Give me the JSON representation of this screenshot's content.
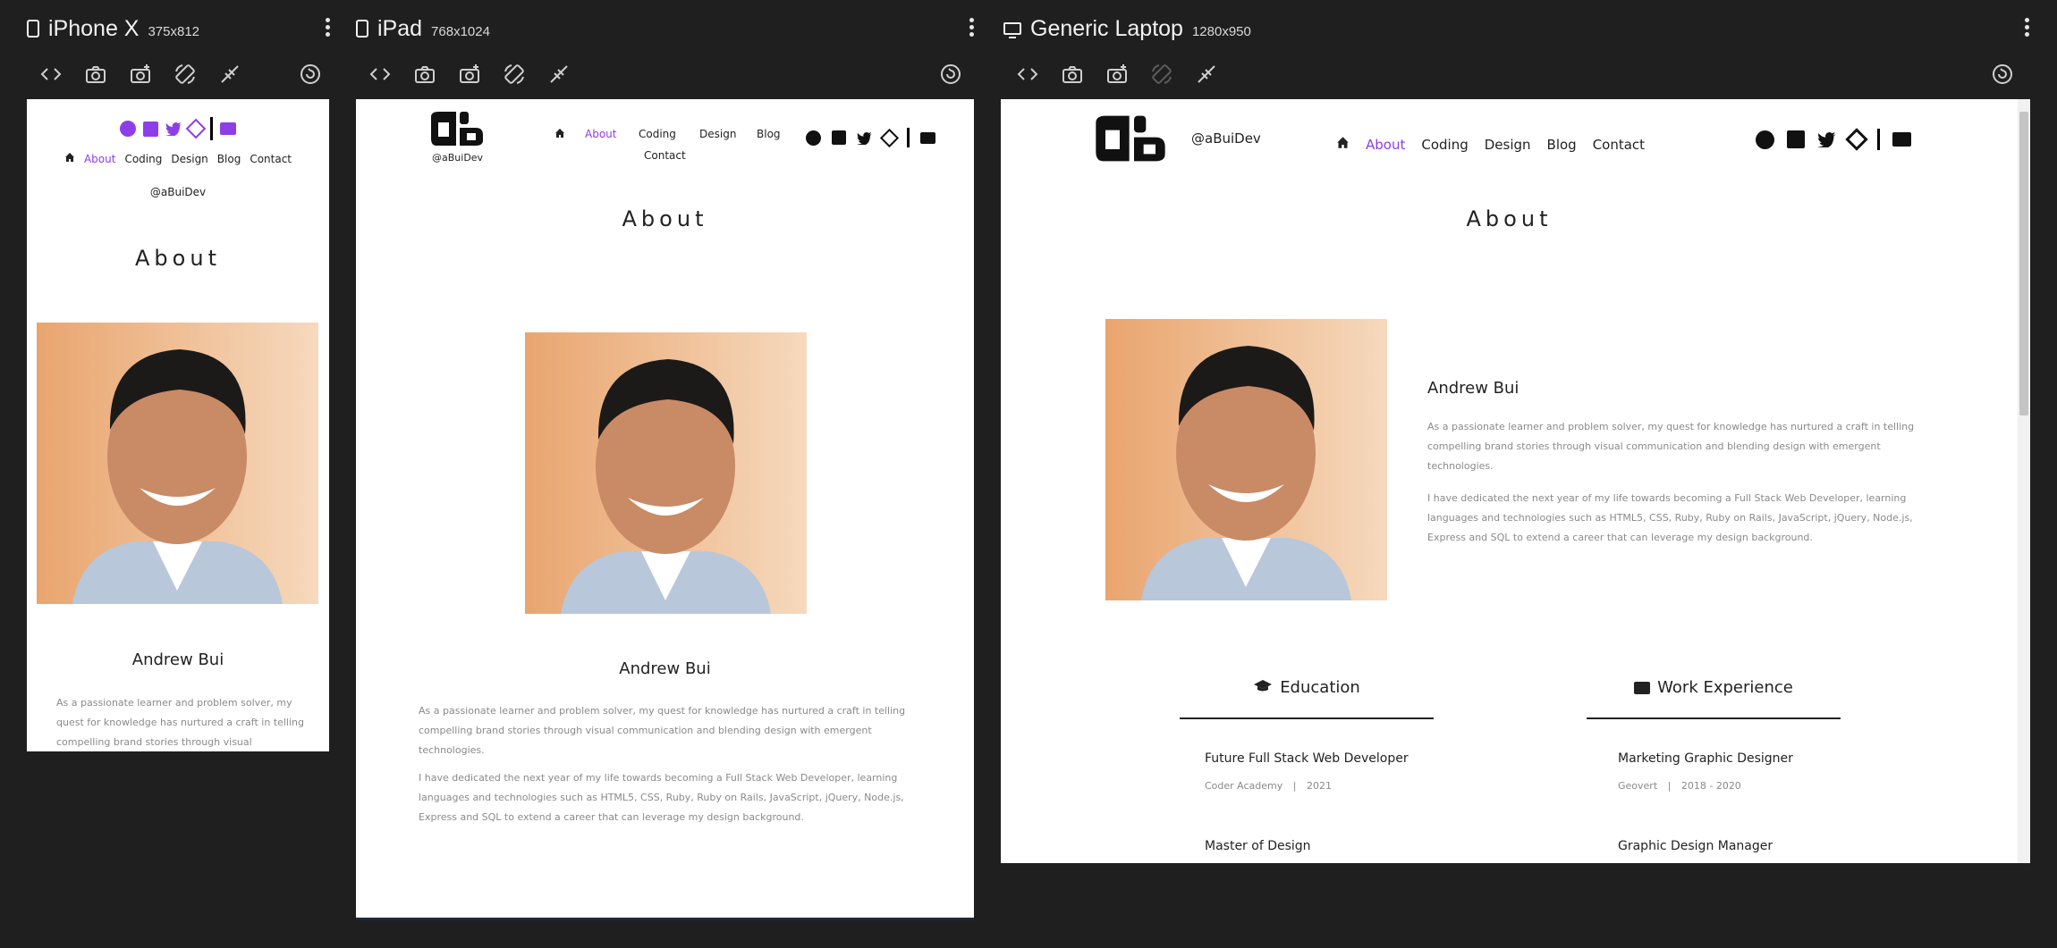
{
  "devices": {
    "iphone": {
      "name": "iPhone X",
      "size": "375x812"
    },
    "ipad": {
      "name": "iPad",
      "size": "768x1024"
    },
    "laptop": {
      "name": "Generic Laptop",
      "size": "1280x950"
    }
  },
  "site": {
    "handle": "@aBuiDev",
    "nav": {
      "about": "About",
      "coding": "Coding",
      "design": "Design",
      "blog": "Blog",
      "contact": "Contact"
    },
    "page_title": "About",
    "name": "Andrew Bui",
    "bio_1": "As a passionate learner and problem solver, my quest for knowledge has nurtured a craft in telling compelling brand stories through visual communication and blending design with emergent technologies.",
    "bio_2": "I have dedicated the next year of my life towards becoming a Full Stack Web Developer, learning languages and technologies such as HTML5, CSS, Ruby, Ruby on Rails, JavaScript, jQuery, Node.js, Express and SQL to extend a career that can leverage my design background.",
    "iphone_bio_1a": "As a passionate learner and problem solver, my",
    "iphone_bio_1b": "quest for knowledge has nurtured a craft in telling",
    "iphone_bio_1c": "compelling brand stories through visual",
    "ipad_bio_1a": "As a passionate learner and problem solver, my quest for knowledge has nurtured a craft in telling",
    "ipad_bio_1b": "compelling brand stories through visual communication and blending design with emergent",
    "ipad_bio_1c": "technologies.",
    "ipad_bio_2a": "I have dedicated the next year of my life towards becoming a Full Stack Web Developer, learning",
    "ipad_bio_2b": "languages and technologies such as HTML5, CSS, Ruby, Ruby on Rails, JavaScript, jQuery, Node.js,",
    "ipad_bio_2c": "Express and SQL to extend a career that can leverage my design background.",
    "laptop_bio_1a": "As a passionate learner and problem solver, my quest for knowledge has nurtured a craft in telling",
    "laptop_bio_1b": "compelling brand stories through visual communication and blending design with emergent",
    "laptop_bio_1c": "technologies.",
    "laptop_bio_2a": "I have dedicated the next year of my life towards becoming a Full Stack Web Developer, learning",
    "laptop_bio_2b": "languages and technologies such as HTML5, CSS, Ruby, Ruby on Rails, JavaScript, jQuery, Node.js,",
    "laptop_bio_2c": "Express and SQL to extend a career that can leverage my design background.",
    "education": {
      "heading": "Education",
      "items": [
        {
          "title": "Future Full Stack Web Developer",
          "org": "Coder Academy",
          "sep": "|",
          "year": "2021"
        },
        {
          "title": "Master of Design"
        }
      ]
    },
    "work": {
      "heading": "Work Experience",
      "items": [
        {
          "title": "Marketing Graphic Designer",
          "org": "Geovert",
          "sep": "|",
          "year": "2018 - 2020"
        },
        {
          "title": "Graphic Design Manager"
        }
      ]
    }
  },
  "colors": {
    "accent": "#8d3ee8",
    "chrome": "#1f1f1f",
    "text": "#222222",
    "muted": "#8a8a8a"
  }
}
